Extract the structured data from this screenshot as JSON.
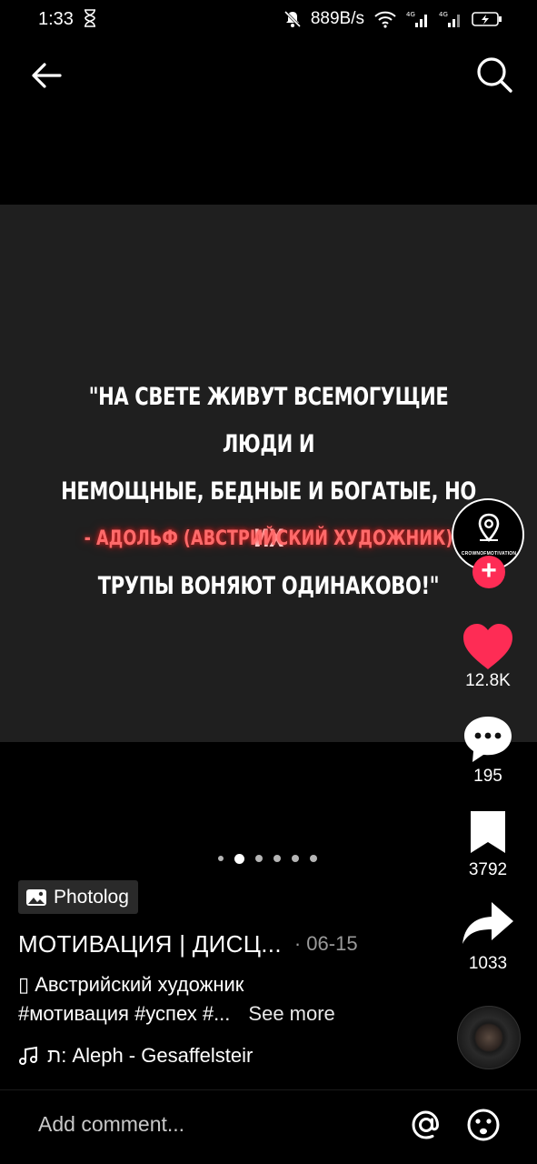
{
  "status_bar": {
    "time": "1:33",
    "hourglass_icon": "hourglass-icon",
    "network_speed": "889B/s",
    "icons": [
      "mute-bell-icon",
      "wifi-icon",
      "signal-4g-icon",
      "signal-4g-icon-2",
      "battery-charging-icon"
    ]
  },
  "nav": {
    "back_icon": "arrow-left-icon",
    "search_icon": "search-icon"
  },
  "post": {
    "quote_lines": [
      "\"НА СВЕТЕ ЖИВУТ ВСЕМОГУЩИЕ ЛЮДИ И",
      "НЕМОЩНЫЕ, БЕДНЫЕ И БОГАТЫЕ, НО ИХ",
      "ТРУПЫ ВОНЯЮТ ОДИНАКОВО!\""
    ],
    "quote_author": "- АДОЛЬФ (АВСТРИЙСКИЙ ХУДОЖНИК)",
    "slides": {
      "count": 6,
      "active_index": 1
    }
  },
  "rail": {
    "avatar_text": "CROWNOFMOTIVATION",
    "follow_label": "+",
    "likes": "12.8K",
    "comments": "195",
    "bookmarks": "3792",
    "shares": "1033"
  },
  "caption": {
    "photolog_label": "Photolog",
    "author": "МОТИВАЦИЯ | ДИСЦ...",
    "date": "· 06-15",
    "description": "▯ Австрийский художник",
    "hashtags": "#мотивация #успех #...",
    "see_more": "See more",
    "music": "ת: Aleph - Gesaffelsteir"
  },
  "comment_bar": {
    "placeholder": "Add comment...",
    "at_icon": "at-icon",
    "emoji_icon": "emoji-icon"
  },
  "colors": {
    "background": "#000000",
    "media_background": "#1f1f1f",
    "accent_red": "#fe2c55",
    "quote_author_glow": "#ff3b3b"
  }
}
